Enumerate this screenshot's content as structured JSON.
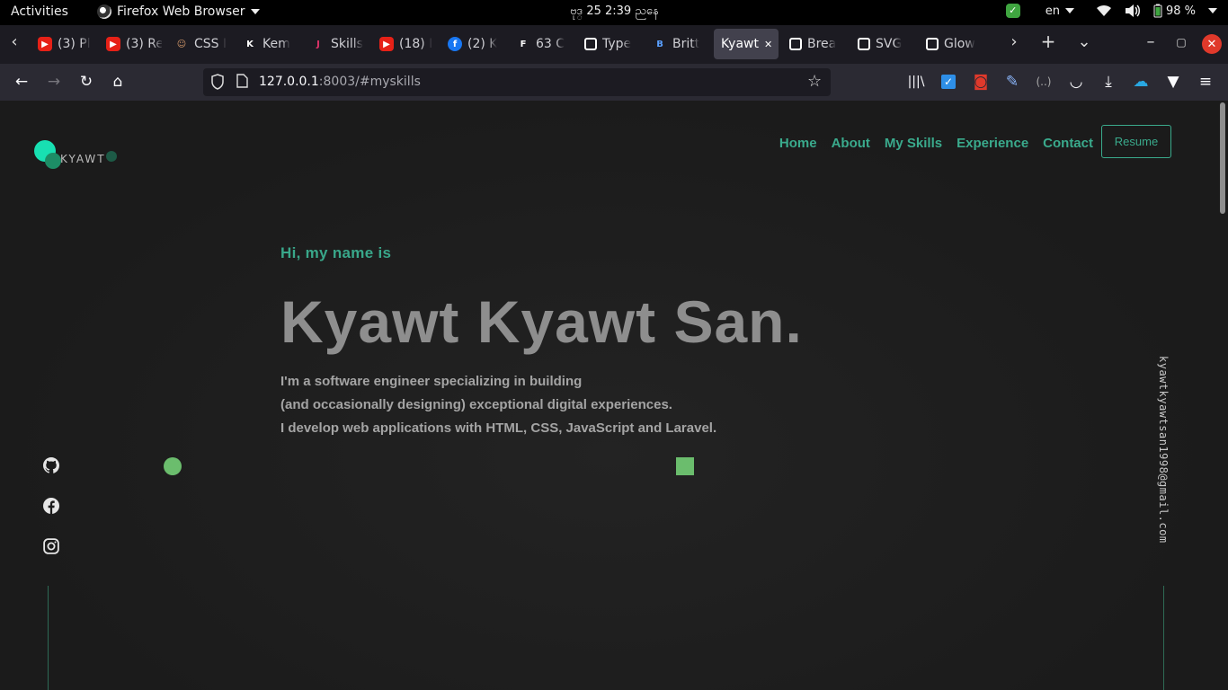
{
  "system_bar": {
    "activities": "Activities",
    "app_name": "Firefox Web Browser",
    "clock": "ဗုဒ္ 25   2:39 ညနေ",
    "language": "en",
    "battery": "98 %"
  },
  "tabs": [
    {
      "label": "(3) Pl",
      "icon": "youtube-icon"
    },
    {
      "label": "(3) Re",
      "icon": "youtube-icon"
    },
    {
      "label": "CSS I",
      "icon": "face-icon"
    },
    {
      "label": "Kem",
      "icon": "k-icon"
    },
    {
      "label": "Skills",
      "icon": "j-icon"
    },
    {
      "label": "(18) I",
      "icon": "youtube-icon"
    },
    {
      "label": "(2) K",
      "icon": "facebook-icon"
    },
    {
      "label": "63 C",
      "icon": "f-icon"
    },
    {
      "label": "Type",
      "icon": "codepen-icon"
    },
    {
      "label": "Britt",
      "icon": "b-icon"
    },
    {
      "label": "Kyawt",
      "icon": "none",
      "active": true
    },
    {
      "label": "Brea",
      "icon": "codepen-icon"
    },
    {
      "label": "SVG",
      "icon": "codepen-icon"
    },
    {
      "label": "Glow",
      "icon": "codepen-icon"
    }
  ],
  "urlbar": {
    "host": "127.0.0.1",
    "path": ":8003/#myskills"
  },
  "site": {
    "logo_text": "KYAWT",
    "nav": [
      "Home",
      "About",
      "My Skills",
      "Experience",
      "Contact"
    ],
    "resume_label": "Resume",
    "greeting": "Hi, my name is",
    "name": "Kyawt Kyawt San.",
    "desc_lines": [
      "I'm a software engineer specializing in building",
      "(and occasionally designing) exceptional digital experiences.",
      "I develop web applications with HTML, CSS, JavaScript and Laravel."
    ],
    "email": "kyawtkyawtsan1998@gmail.com",
    "social": [
      "github-icon",
      "facebook-icon",
      "instagram-icon"
    ]
  },
  "colors": {
    "accent": "#3aaa8c",
    "logo_primary": "#18e0b2",
    "decor_green": "#6bbd6d",
    "background": "#1b1b1b",
    "name_gray": "#8e8e8e"
  }
}
